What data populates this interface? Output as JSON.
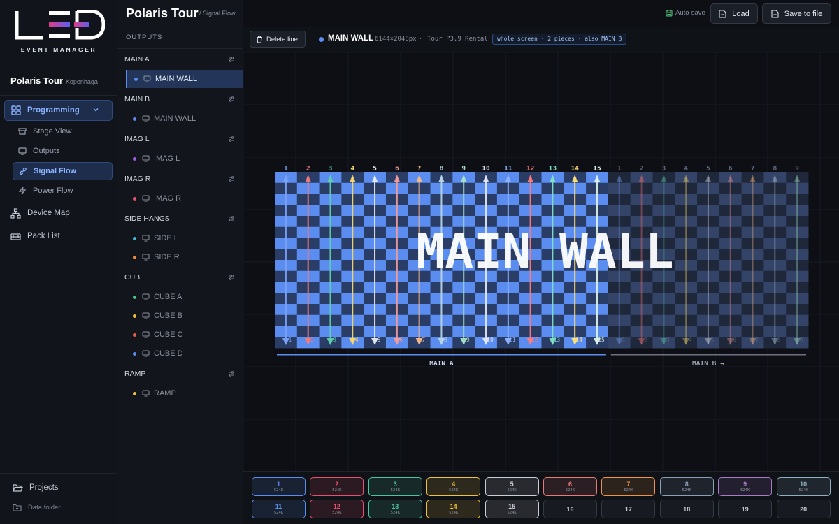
{
  "logo": {
    "text": "LED",
    "subtitle": "EVENT MANAGER"
  },
  "project": {
    "name": "Polaris Tour",
    "city": "Kopenhaga"
  },
  "nav": {
    "programming": "Programming",
    "stage_view": "Stage View",
    "outputs": "Outputs",
    "signal_flow": "Signal Flow",
    "power_flow": "Power Flow",
    "device_map": "Device Map",
    "pack_list": "Pack List",
    "projects": "Projects",
    "data_folder": "Data folder"
  },
  "outputs_panel": {
    "title": "OUTPUTS",
    "groups": [
      {
        "name": "MAIN A",
        "items": [
          {
            "label": "MAIN WALL",
            "color": "#5b8cf0",
            "selected": true
          }
        ]
      },
      {
        "name": "MAIN B",
        "items": [
          {
            "label": "MAIN WALL",
            "color": "#5b8cf0"
          }
        ]
      },
      {
        "name": "IMAG L",
        "items": [
          {
            "label": "IMAG L",
            "color": "#a05ce8"
          }
        ]
      },
      {
        "name": "IMAG R",
        "items": [
          {
            "label": "IMAG R",
            "color": "#e8506e"
          }
        ]
      },
      {
        "name": "SIDE HANGS",
        "items": [
          {
            "label": "SIDE L",
            "color": "#3fb6d6"
          },
          {
            "label": "SIDE R",
            "color": "#f08a3c"
          }
        ]
      },
      {
        "name": "CUBE",
        "items": [
          {
            "label": "CUBE A",
            "color": "#4cc47a"
          },
          {
            "label": "CUBE B",
            "color": "#f0c040"
          },
          {
            "label": "CUBE C",
            "color": "#e85c4a"
          },
          {
            "label": "CUBE D",
            "color": "#5b8cf0"
          }
        ]
      },
      {
        "name": "RAMP",
        "items": [
          {
            "label": "RAMP",
            "color": "#f0c040"
          }
        ]
      }
    ]
  },
  "header": {
    "title": "Polaris Tour",
    "breadcrumb": "/ Signal Flow",
    "autosave": "Auto-save",
    "load": "Load",
    "save": "Save to file"
  },
  "toolbar": {
    "delete_line": "Delete line",
    "screen_name": "MAIN WALL",
    "resolution": "6144×2048px",
    "separator": "·",
    "kit": "Tour P3.9 Rental",
    "badge": "whole screen · 2 pieces · also MAIN B"
  },
  "canvas": {
    "wall_label": "MAIN WALL",
    "main_a_label": "MAIN A",
    "main_b_label": "MAIN B →",
    "main_a_lines": [
      "1",
      "2",
      "3",
      "4",
      "5",
      "6",
      "7",
      "8",
      "9",
      "10",
      "11",
      "12",
      "13",
      "14",
      "15"
    ],
    "main_b_lines": [
      "1",
      "2",
      "3",
      "4",
      "5",
      "6",
      "7",
      "8",
      "9"
    ],
    "line_colors": [
      "#7aa2f7",
      "#f07a7a",
      "#5fd0b0",
      "#f5d76e",
      "#e6eaf0",
      "#f29b9b",
      "#f5b98a",
      "#b8d4e6",
      "#a7e0c8",
      "#e0e6f5",
      "#8fb3ff",
      "#ff7a7a",
      "#7fe0c8",
      "#ffe27a",
      "#d9f0e6"
    ]
  },
  "ports": [
    {
      "num": "1",
      "load": "524K",
      "color": "#5b8cf0"
    },
    {
      "num": "2",
      "load": "524K",
      "color": "#e8506e"
    },
    {
      "num": "3",
      "load": "524K",
      "color": "#4cc4a0"
    },
    {
      "num": "4",
      "load": "524K",
      "color": "#f0c040"
    },
    {
      "num": "5",
      "load": "524K",
      "color": "#c9ced8"
    },
    {
      "num": "6",
      "load": "524K",
      "color": "#e87a7a"
    },
    {
      "num": "7",
      "load": "524K",
      "color": "#f0944a"
    },
    {
      "num": "8",
      "load": "524K",
      "color": "#8aa0b8"
    },
    {
      "num": "9",
      "load": "524K",
      "color": "#a87ac8"
    },
    {
      "num": "10",
      "load": "524K",
      "color": "#8fb0c0"
    },
    {
      "num": "11",
      "load": "524K",
      "color": "#5b8cf0"
    },
    {
      "num": "12",
      "load": "524K",
      "color": "#e8506e"
    },
    {
      "num": "13",
      "load": "524K",
      "color": "#4cc4a0"
    },
    {
      "num": "14",
      "load": "524K",
      "color": "#f0c040"
    },
    {
      "num": "15",
      "load": "524K",
      "color": "#c9ced8"
    },
    {
      "num": "16",
      "load": "",
      "color": ""
    },
    {
      "num": "17",
      "load": "",
      "color": ""
    },
    {
      "num": "18",
      "load": "",
      "color": ""
    },
    {
      "num": "19",
      "load": "",
      "color": ""
    },
    {
      "num": "20",
      "load": "",
      "color": ""
    }
  ]
}
